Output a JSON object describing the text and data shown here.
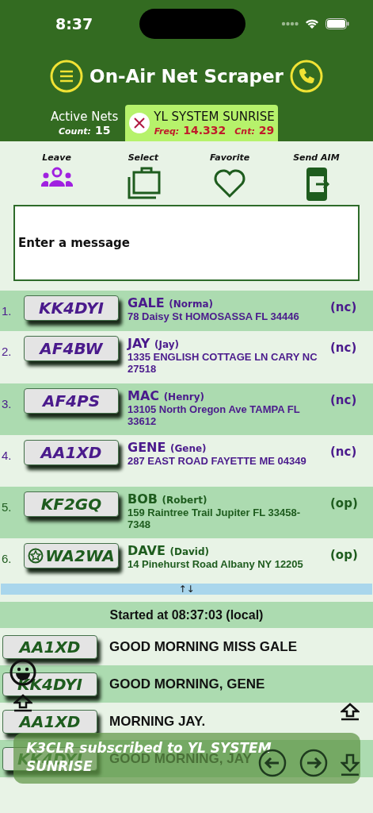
{
  "status_bar": {
    "time": "8:37"
  },
  "header": {
    "title": "On-Air Net Scraper"
  },
  "tabs": [
    {
      "kind": "summary",
      "label": "Active Nets",
      "count_label": "Count:",
      "count": "15",
      "selected": false
    },
    {
      "kind": "net",
      "label": "YL SYSTEM SUNRISE",
      "freq_label": "Freq:",
      "freq": "14.332",
      "cnt_label": "Cnt:",
      "cnt": "29",
      "selected": true
    }
  ],
  "actions": [
    {
      "kind": "leave",
      "label": "Leave"
    },
    {
      "kind": "select",
      "label": "Select"
    },
    {
      "kind": "favorite",
      "label": "Favorite"
    },
    {
      "kind": "send",
      "label": "Send AIM"
    }
  ],
  "message": {
    "placeholder": "Enter a message"
  },
  "roster": [
    {
      "number": "1.",
      "callsign": "KK4DYI",
      "favorite": false,
      "name": "GALE",
      "nickname": "(Norma)",
      "address": "78 Daisy St HOMOSASSA FL 34446",
      "status": "(nc)",
      "color": "#4a1a8c"
    },
    {
      "number": "2.",
      "callsign": "AF4BW",
      "favorite": false,
      "name": "JAY",
      "nickname": "(Jay)",
      "address": "1335 ENGLISH COTTAGE LN CARY NC 27518",
      "status": "(nc)",
      "color": "#4a1a8c"
    },
    {
      "number": "3.",
      "callsign": "AF4PS",
      "favorite": false,
      "name": "MAC",
      "nickname": "(Henry)",
      "address": "13105 North Oregon Ave TAMPA FL 33612",
      "status": "(nc)",
      "color": "#4a1a8c"
    },
    {
      "number": "4.",
      "callsign": "AA1XD",
      "favorite": false,
      "name": "GENE",
      "nickname": "(Gene)",
      "address": "287 EAST ROAD FAYETTE ME 04349",
      "status": "(nc)",
      "color": "#4a1a8c"
    },
    {
      "number": "5.",
      "callsign": "KF2GQ",
      "favorite": false,
      "name": "BOB",
      "nickname": "(Robert)",
      "address": "159 Raintree Trail Jupiter FL 33458-7348",
      "status": "(op)",
      "color": "#1e5c1e"
    },
    {
      "number": "6.",
      "callsign": "WA2WA",
      "favorite": true,
      "name": "DAVE",
      "nickname": "(David)",
      "address": "14 Pinehurst Road Albany NY 12205",
      "status": "(op)",
      "color": "#1e5c1e"
    }
  ],
  "splitter": {
    "label": "↑↓"
  },
  "log": {
    "header": "Started at 08:37:03 (local)",
    "messages": [
      {
        "callsign": "AA1XD",
        "text": "GOOD MORNING MISS GALE"
      },
      {
        "callsign": "KK4DYI",
        "text": "GOOD MORNING, GENE"
      },
      {
        "callsign": "AA1XD",
        "text": "MORNING JAY."
      },
      {
        "callsign": "KK4DYI",
        "text": "GOOD MORNING, JAY"
      }
    ]
  },
  "toast": {
    "text": "K3CLR subscribed to YL SYSTEM SUNRISE"
  }
}
